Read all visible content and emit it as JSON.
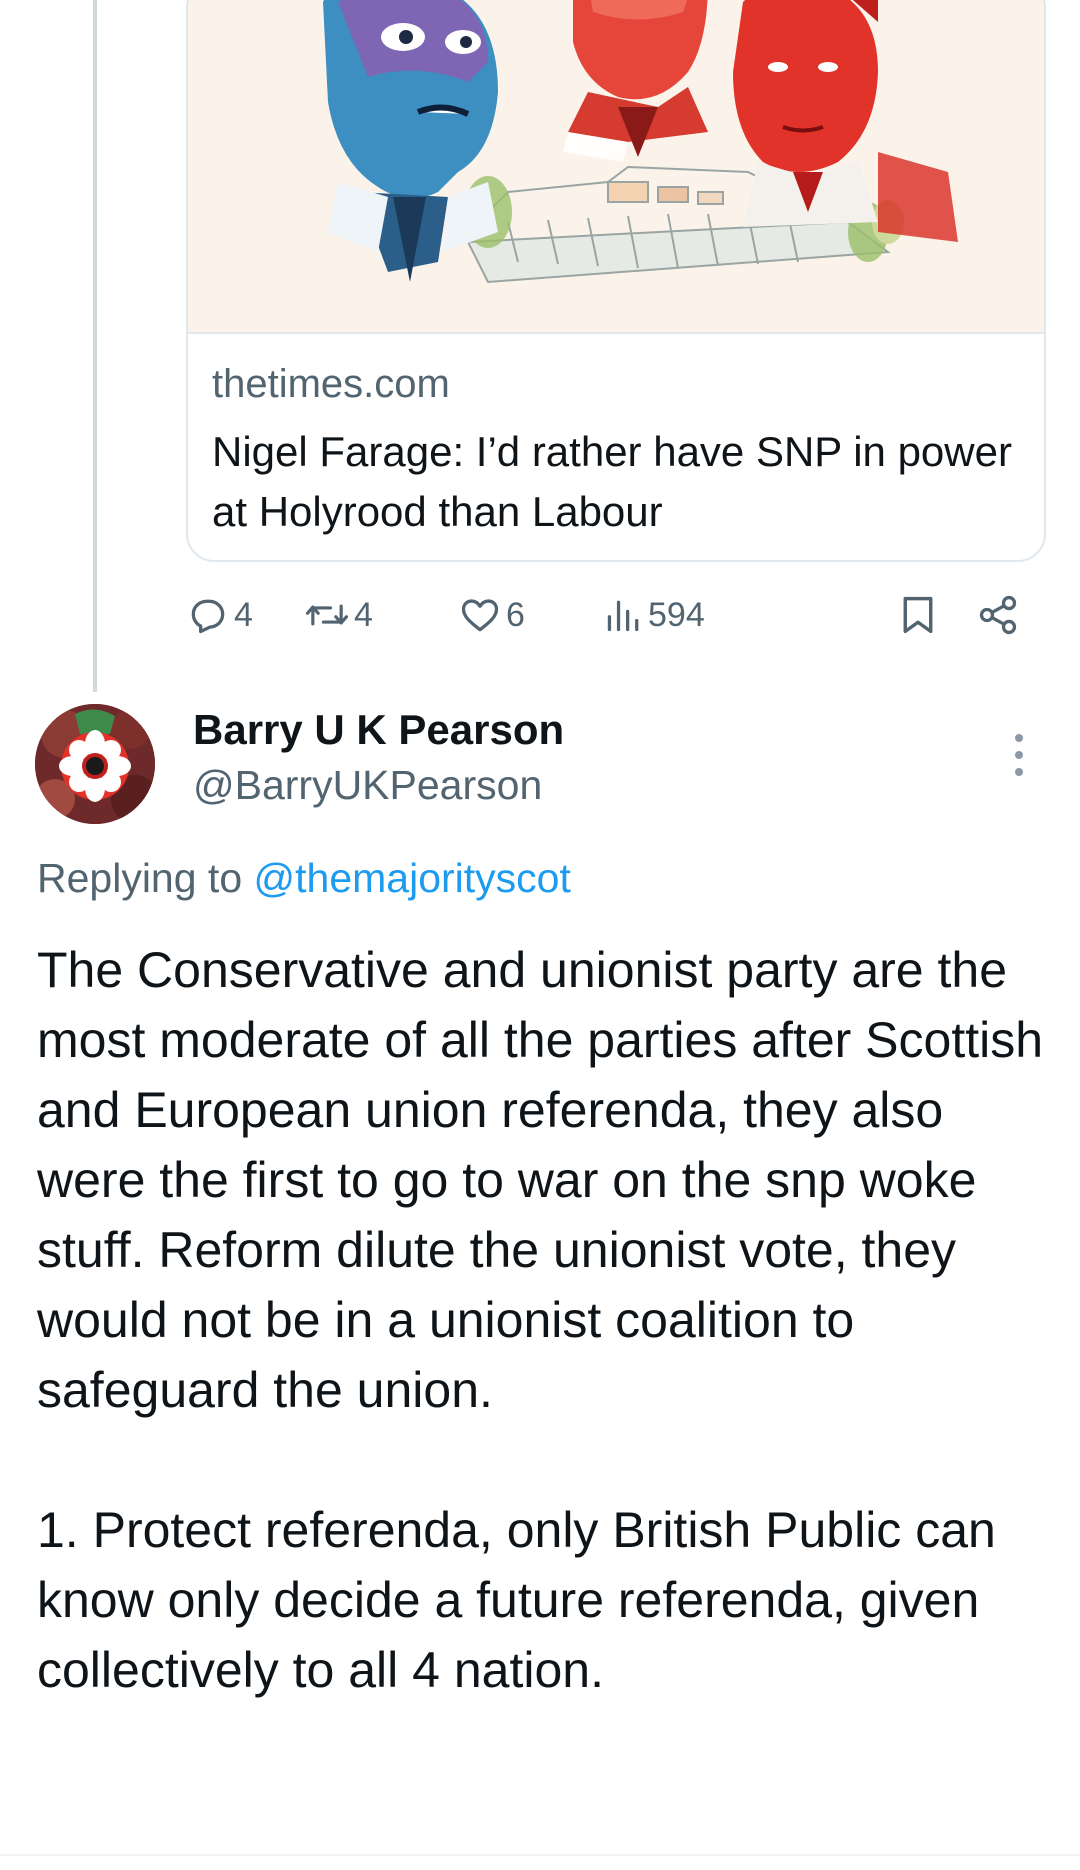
{
  "quoted_card": {
    "domain": "thetimes.com",
    "title": "Nigel Farage: I’d rather have SNP in power at Holyrood than Labour"
  },
  "engagement": {
    "replies": "4",
    "reposts": "4",
    "likes": "6",
    "views": "594"
  },
  "reply": {
    "author_name": "Barry U K Pearson",
    "author_handle": "@BarryUKPearson",
    "replying_prefix": "Replying to",
    "replying_to": "@themajorityscot",
    "paragraphs": [
      "The Conservative and unionist party are the most moderate of all the parties after Scottish and European union referenda, they also were the first to go to war on the snp woke stuff. Reform dilute the unionist vote, they would not be in a unionist coalition to safeguard the union.",
      "1. Protect referenda, only British Public can know only decide a future referenda, given collectively to all 4 nation."
    ]
  },
  "icons": {
    "reply": "reply-icon",
    "repost": "repost-icon",
    "like": "heart-icon",
    "views": "views-icon",
    "bookmark": "bookmark-icon",
    "share": "share-icon",
    "more": "more-icon"
  },
  "colors": {
    "text": "#0f1419",
    "secondary": "#536471",
    "link": "#1d9bf0",
    "border": "#e1e8ed"
  }
}
